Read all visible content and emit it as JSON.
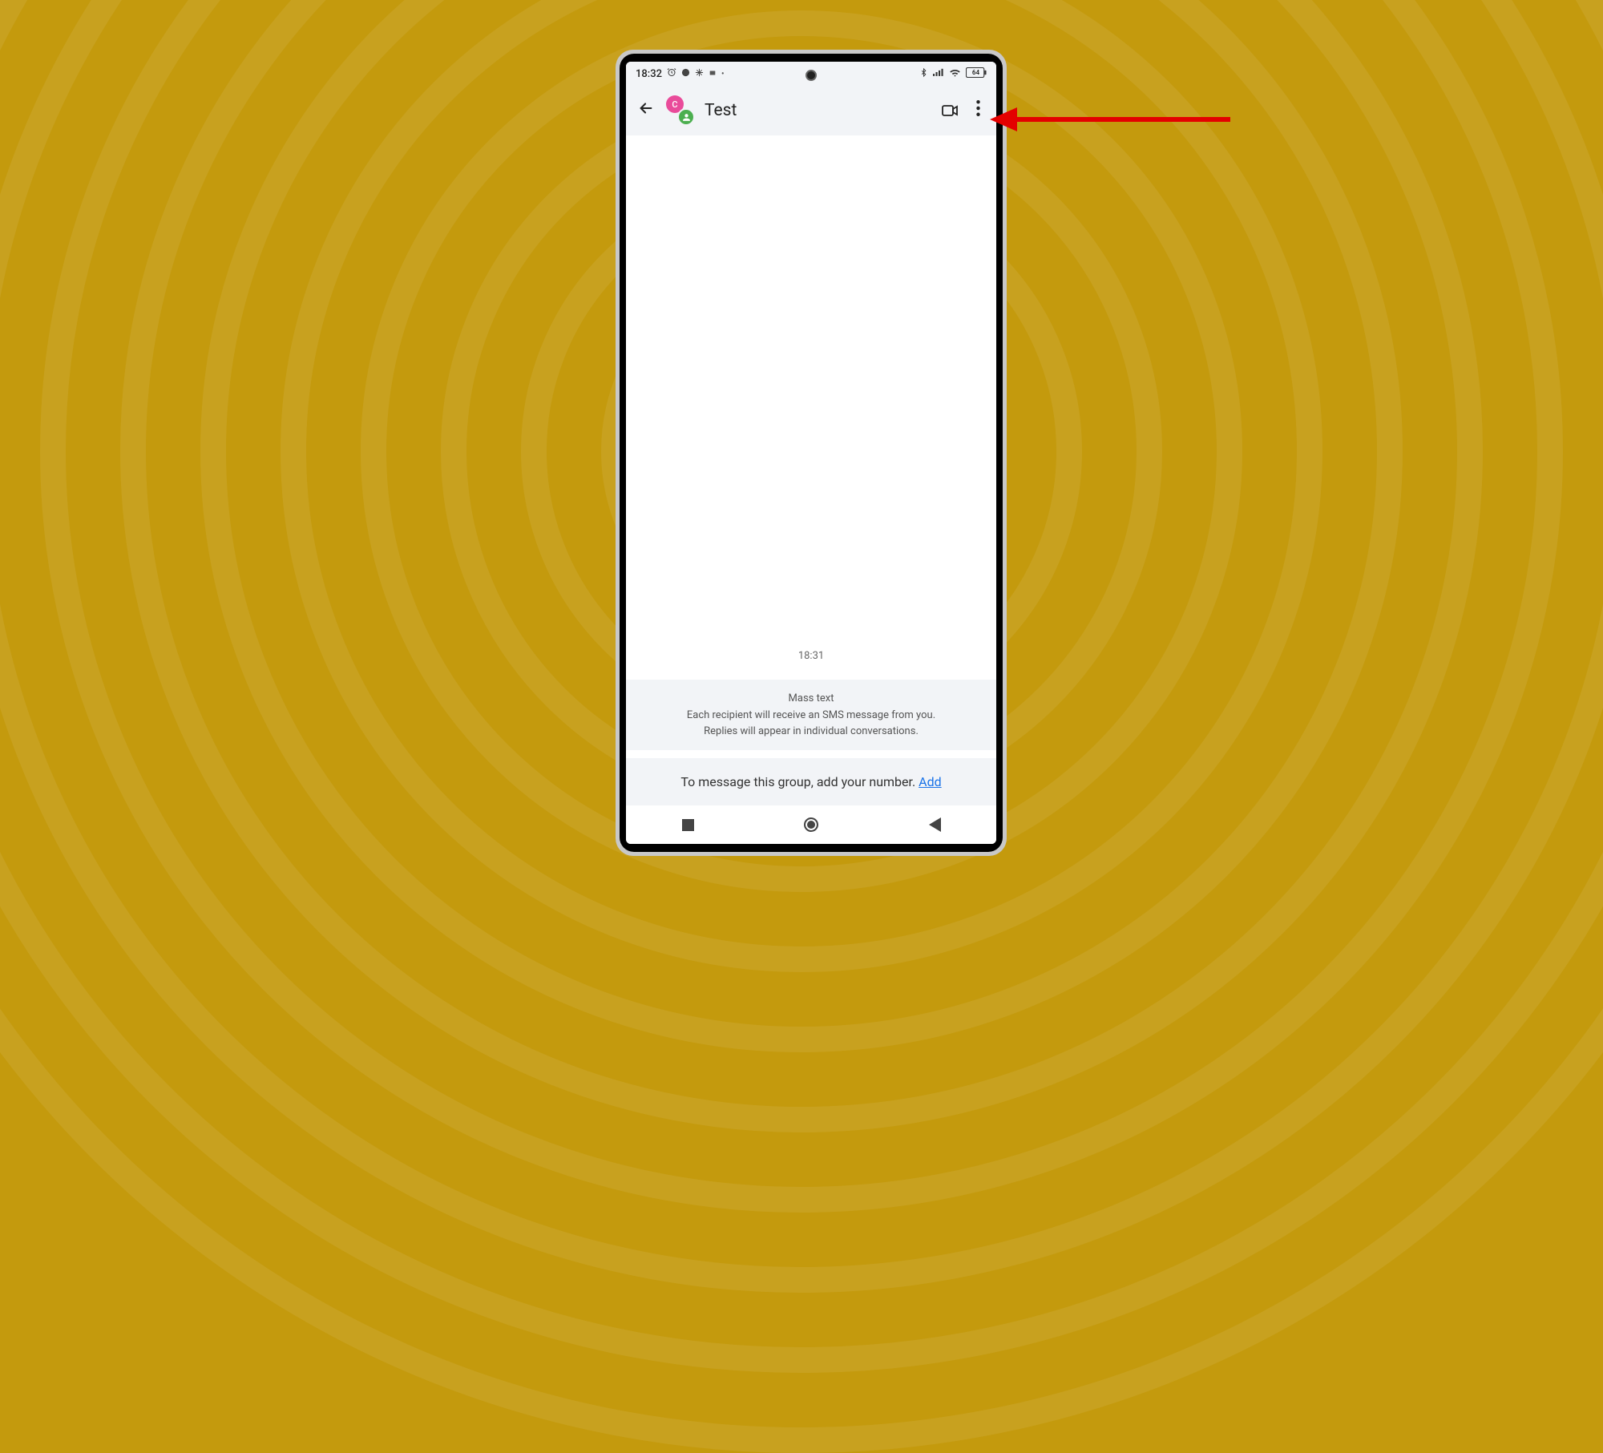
{
  "statusbar": {
    "time": "18:32",
    "battery": "64"
  },
  "header": {
    "title": "Test",
    "avatar1_letter": "C"
  },
  "conversation": {
    "timestamp": "18:31",
    "info_title": "Mass text",
    "info_line1": "Each recipient will receive an SMS message from you.",
    "info_line2": "Replies will appear in individual conversations.",
    "prompt_text": "To message this group, add your number. ",
    "prompt_link": "Add"
  }
}
